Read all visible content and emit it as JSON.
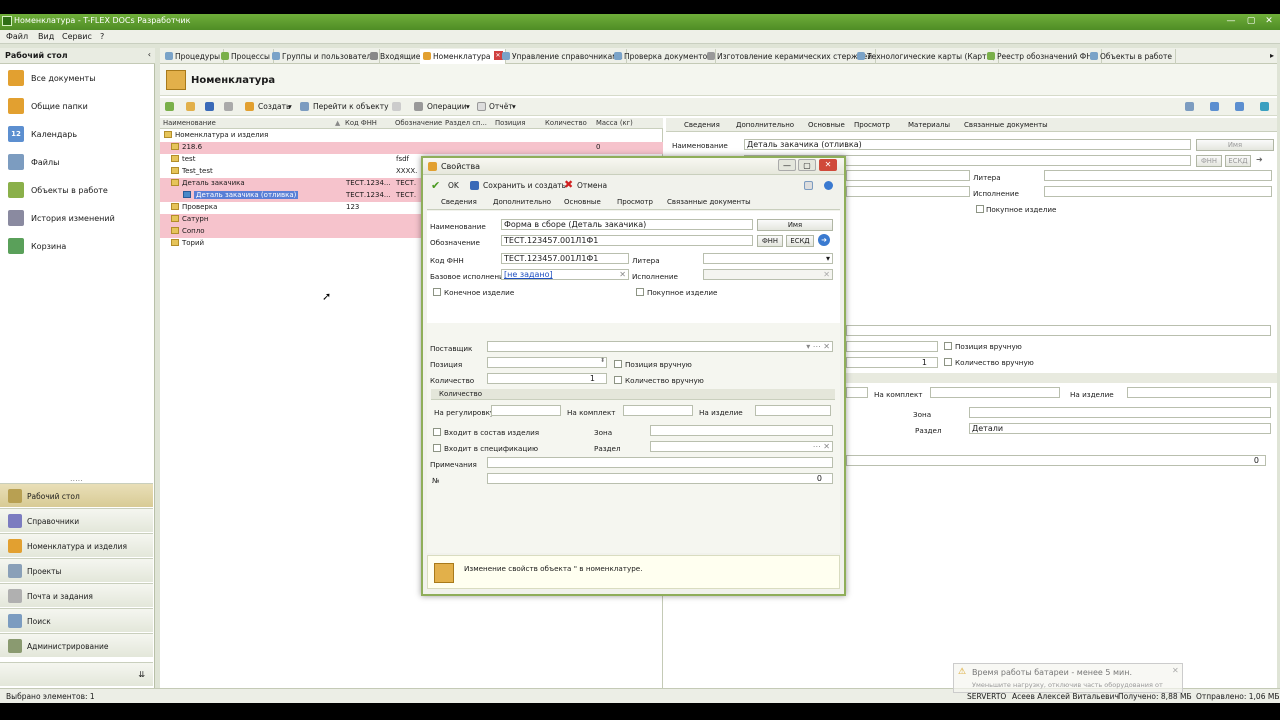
{
  "window": {
    "title": "Номенклатура - T-FLEX DOCs Разработчик",
    "controls": [
      "—",
      "▢",
      "✕"
    ]
  },
  "menu": [
    "Файл",
    "Вид",
    "Сервис",
    "?"
  ],
  "sidebar": {
    "title": "Рабочий стол",
    "items": [
      {
        "label": "Все документы",
        "color": "#e2a030"
      },
      {
        "label": "Общие папки",
        "color": "#e2a030"
      },
      {
        "label": "Календарь",
        "color": "#5c8fd0",
        "badge": "12"
      },
      {
        "label": "Файлы",
        "color": "#7c9cc0"
      },
      {
        "label": "Объекты в работе",
        "color": "#8ab04a"
      },
      {
        "label": "История изменений",
        "color": "#8a8aa0"
      },
      {
        "label": "Корзина",
        "color": "#5aa05a"
      }
    ],
    "nav": [
      {
        "label": "Рабочий стол",
        "color": "#b8a052"
      },
      {
        "label": "Справочники",
        "color": "#7c7cc0"
      },
      {
        "label": "Номенклатура и изделия",
        "color": "#e2a030"
      },
      {
        "label": "Проекты",
        "color": "#8aa0b8"
      },
      {
        "label": "Почта и задания",
        "color": "#b0b0b0"
      },
      {
        "label": "Поиск",
        "color": "#7c9cc0"
      },
      {
        "label": "Администрирование",
        "color": "#8a9a70"
      }
    ],
    "more": "....."
  },
  "tabs": [
    "Процедуры",
    "Процессы",
    "Группы и пользователи",
    "Входящие",
    "Номенклатура",
    "Управление справочниками",
    "Проверка документов",
    "Изготовление керамических стержней",
    "Технологические карты (Карты)",
    "Реестр обозначений ФНН",
    "Объекты в работе"
  ],
  "page": {
    "title": "Номенклатура",
    "toolbar": {
      "create": "Создать",
      "goto": "Перейти к объекту",
      "operations": "Операции",
      "report": "Отчёт"
    }
  },
  "grid": {
    "columns": [
      "Наименование",
      "Код ФНН",
      "Обозначение",
      "Раздел сп...",
      "Позиция",
      "Количество",
      "Масса (кг)"
    ],
    "root": "Номенклатура и изделия",
    "rows": [
      {
        "name": "218.6",
        "kod": "",
        "obozn": "",
        "massa": "0",
        "style": "pink",
        "indent": 0
      },
      {
        "name": "test",
        "kod": "",
        "obozn": "fsdf",
        "massa": "",
        "style": "",
        "indent": 0
      },
      {
        "name": "Test_test",
        "kod": "",
        "obozn": "XXXX.",
        "massa": "",
        "style": "",
        "indent": 0
      },
      {
        "name": "Деталь закачика",
        "kod": "ТЕСТ.1234...",
        "obozn": "ТЕСТ.",
        "massa": "",
        "style": "pink",
        "indent": 0
      },
      {
        "name": "Деталь закачика (отливка)",
        "kod": "ТЕСТ.1234...",
        "obozn": "ТЕСТ.",
        "massa": "",
        "style": "sel",
        "indent": 1
      },
      {
        "name": "Проверка",
        "kod": "123",
        "obozn": "",
        "massa": "",
        "style": "",
        "indent": 0
      },
      {
        "name": "Сатурн",
        "kod": "",
        "obozn": "",
        "massa": "",
        "style": "pink",
        "indent": 0
      },
      {
        "name": "Сопло",
        "kod": "",
        "obozn": "",
        "massa": "",
        "style": "pink",
        "indent": 0
      },
      {
        "name": "Торий",
        "kod": "",
        "obozn": "",
        "massa": "",
        "style": "",
        "indent": 0
      }
    ]
  },
  "right": {
    "tabs": [
      "Сведения",
      "Дополнительно",
      "Основные",
      "Просмотр",
      "Материалы",
      "Связанные документы"
    ],
    "name_label": "Наименование",
    "name_value": "Деталь закачика (отливка)",
    "name_btn": "Имя",
    "fnn": "ФНН",
    "eskd": "ЕСКД",
    "litera": "Литера",
    "ispolnenie": "Исполнение",
    "pokupnoe": "Покупное изделие",
    "poz_vruch": "Позиция вручную",
    "kol_vruch": "Количество вручную",
    "kol_value": "1",
    "na_komplekt": "На комплект",
    "na_izdelie": "На изделие",
    "zona": "Зона",
    "razdel": "Раздел",
    "razdel_value": "Детали",
    "num_value": "0"
  },
  "dialog": {
    "title": "Свойства",
    "ok": "OK",
    "save_create": "Сохранить и создать",
    "cancel": "Отмена",
    "tabs": [
      "Сведения",
      "Дополнительно",
      "Основные",
      "Просмотр",
      "Связанные документы"
    ],
    "fields": {
      "name_label": "Наименование",
      "name_value": "Форма в сборе (Деталь закачика)",
      "name_btn": "Имя",
      "obozn_label": "Обозначение",
      "obozn_value": "ТЕСТ.123457.001Л1Ф1",
      "fnn_btn": "ФНН",
      "eskd_btn": "ЕСКД",
      "kod_label": "Код ФНН",
      "kod_value": "ТЕСТ.123457.001Л1Ф1",
      "litera_label": "Литера",
      "base_label": "Базовое исполнение",
      "base_value": "[не задано]",
      "ispoln_label": "Исполнение",
      "konech": "Конечное изделие",
      "pokup": "Покупное изделие",
      "postav_label": "Поставщик",
      "poz_label": "Позиция",
      "poz_vruch": "Позиция вручную",
      "kol_label": "Количество",
      "kol_value": "1",
      "kol_vruch": "Количество вручную",
      "group_kol": "Количество",
      "na_reg": "На регулировку",
      "na_kompl": "На комплект",
      "na_izd": "На изделие",
      "vhodit_sostav": "Входит в состав изделия",
      "zona": "Зона",
      "vhodit_spec": "Входит в спецификацию",
      "razdel": "Раздел",
      "prim": "Примечания",
      "num_label": "№",
      "num_value": "0"
    },
    "footer": "Изменение свойств объекта \" в номенклатуре."
  },
  "status": {
    "selected": "Выбрано элементов: 1",
    "server": "SERVERTO",
    "user": "Асеев Алексей Витальевич",
    "received": "Получено: 8,88 МБ",
    "sent": "Отправлено: 1,06 МБ"
  },
  "toast": {
    "title": "Время работы батареи - менее 5 мин.",
    "text": "Уменьшите нагрузку, отключив часть оборудования от"
  },
  "colors": {
    "accent": "#5f9e2f",
    "pink": "#f6c3cc",
    "select": "#5a7fd6"
  }
}
